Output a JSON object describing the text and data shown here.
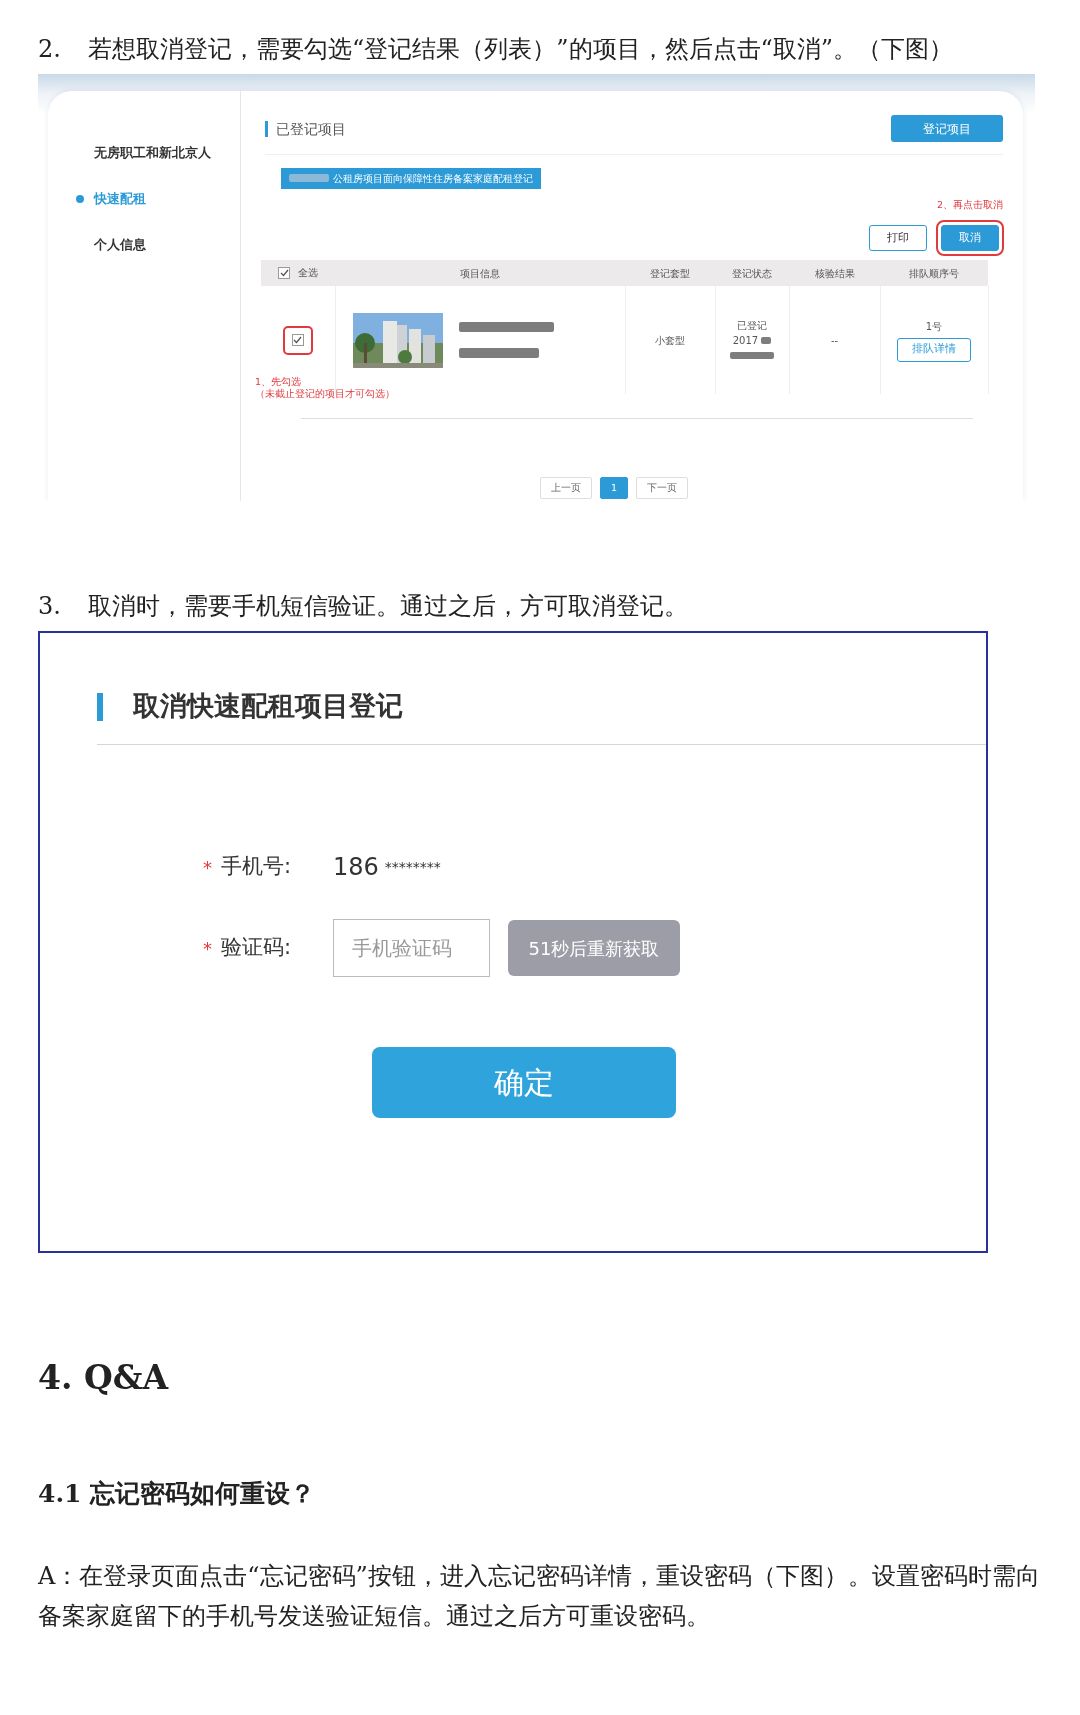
{
  "step_2": {
    "number": "2.",
    "text": "若想取消登记，需要勾选“登记结果（列表）”的项目，然后点击“取消”。（下图）"
  },
  "screenshot_1": {
    "sidebar": {
      "items": [
        {
          "label": "无房职工和新北京人",
          "selected": false
        },
        {
          "label": "快速配租",
          "selected": true
        },
        {
          "label": "个人信息",
          "selected": false
        }
      ]
    },
    "header": {
      "title": "已登记项目",
      "button": "登记项目"
    },
    "banner": "公租房项目面向保障性住房备案家庭配租登记",
    "hint_cancel": "2、再点击取消",
    "actions": [
      {
        "label": "打印",
        "highlighted": false
      },
      {
        "label": "取消",
        "highlighted": true
      }
    ],
    "table": {
      "select_all": {
        "label": "全选",
        "checked": true
      },
      "columns": [
        "项目信息",
        "登记套型",
        "登记状态",
        "核验结果",
        "排队顺序号"
      ],
      "rows": [
        {
          "checked": true,
          "highlighted": true,
          "hint": "1、先勾选",
          "hint_note": "（未截止登记的项目才可勾选）",
          "unit_type": "小套型",
          "status": "已登记",
          "status_date": "2017",
          "verification": "--",
          "queue_number": "1号",
          "detail_button": "排队详情"
        }
      ]
    },
    "pagination": {
      "prev": "上一页",
      "pages": [
        {
          "label": "1",
          "selected": true
        }
      ],
      "next": "下一页"
    }
  },
  "step_3": {
    "number": "3.",
    "text": "取消时，需要手机短信验证。通过之后，方可取消登记。"
  },
  "dialog": {
    "title": "取消快速配租项目登记",
    "fields": [
      {
        "kind": "text",
        "label": "手机号:",
        "required_mark": "*",
        "value": "186",
        "masked": "********"
      },
      {
        "kind": "code",
        "label": "验证码:",
        "required_mark": "*",
        "placeholder": "手机验证码",
        "resend_button": "51秒后重新获取",
        "resend_disabled": true
      }
    ],
    "confirm": "确定"
  },
  "section_heading": "4. Q&A",
  "subheading": "4.1 忘记密码如何重设？",
  "answer": "A：在登录页面点击“忘记密码”按钮，进入忘记密码详情，重设密码（下图）。设置密码时需向备案家庭留下的手机号发送验证短信。通过之后方可重设密码。"
}
